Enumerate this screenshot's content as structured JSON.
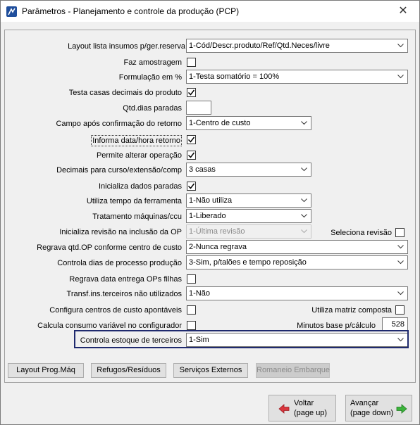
{
  "window": {
    "title": "Parâmetros - Planejamento e controle da produção (PCP)",
    "close": "✕"
  },
  "colors": {
    "accent": "#1f2a6e",
    "check": "#000000"
  },
  "rows": {
    "layout_lista": {
      "label": "Layout lista insumos p/ger.reserva",
      "value": "1-Cód/Descr.produto/Ref/Qtd.Neces/livre"
    },
    "faz_amostragem": {
      "label": "Faz amostragem",
      "checked": false
    },
    "formulacao": {
      "label": "Formulação em %",
      "value": "1-Testa somatório = 100%"
    },
    "testa_casas": {
      "label": "Testa casas decimais do produto",
      "checked": true
    },
    "qtd_dias": {
      "label": "Qtd.dias paradas",
      "value": ""
    },
    "campo_apos": {
      "label": "Campo após confirmação do retorno",
      "value": "1-Centro de custo"
    },
    "informa_data": {
      "label": "Informa data/hora retorno",
      "checked": true
    },
    "permite_alterar": {
      "label": "Permite alterar operação",
      "checked": true
    },
    "decimais": {
      "label": "Decimais para curso/extensão/comp",
      "value": "3 casas"
    },
    "inicializa_dados": {
      "label": "Inicializa dados paradas",
      "checked": true
    },
    "utiliza_tempo": {
      "label": "Utiliza tempo da ferramenta",
      "value": "1-Não utiliza"
    },
    "tratamento": {
      "label": "Tratamento máquinas/ccu",
      "value": "1-Liberado"
    },
    "inicializa_revisao": {
      "label": "Inicializa revisão na inclusão da OP",
      "value": "1-Última revisão"
    },
    "seleciona_revisao": {
      "label": "Seleciona revisão",
      "checked": false
    },
    "regrava_qtd": {
      "label": "Regrava qtd.OP conforme centro de custo",
      "value": "2-Nunca regrava"
    },
    "controla_dias": {
      "label": "Controla dias de processo produção",
      "value": "3-Sim, p/talões e tempo reposição"
    },
    "regrava_data": {
      "label": "Regrava data entrega OPs filhas",
      "checked": false
    },
    "transf_ins": {
      "label": "Transf.ins.terceiros não utilizados",
      "value": "1-Não"
    },
    "configura_centros": {
      "label": "Configura centros de custo apontáveis",
      "checked": false
    },
    "utiliza_matriz": {
      "label": "Utiliza matriz composta",
      "checked": false
    },
    "calcula_consumo": {
      "label": "Calcula consumo variável no configurador",
      "checked": false
    },
    "minutos_base": {
      "label": "Minutos base p/cálculo",
      "value": "528"
    },
    "controla_estoque": {
      "label": "Controla estoque de terceiros",
      "value": "1-Sim"
    }
  },
  "buttons": {
    "layout_prog": "Layout Prog.Máq",
    "refugos": "Refugos/Resíduos",
    "servicos": "Serviços Externos",
    "romaneio": "Romaneio Embarque",
    "voltar": {
      "line1": "Voltar",
      "line2": "(page up)"
    },
    "avancar": {
      "line1": "Avançar",
      "line2": "(page down)"
    }
  }
}
